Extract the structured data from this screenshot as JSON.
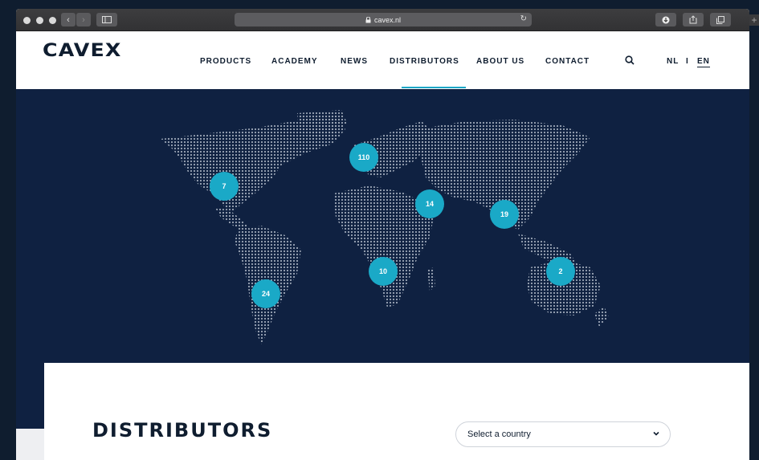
{
  "browser": {
    "url": "cavex.nl",
    "new_tab": "+"
  },
  "site": {
    "logo": "CAVEX",
    "nav": [
      {
        "label": "PRODUCTS"
      },
      {
        "label": "ACADEMY"
      },
      {
        "label": "NEWS"
      },
      {
        "label": "DISTRIBUTORS"
      },
      {
        "label": "ABOUT US"
      },
      {
        "label": "CONTACT"
      }
    ],
    "lang_nl": "NL",
    "lang_sep": "I",
    "lang_en": "EN"
  },
  "map": {
    "markers": [
      {
        "label": "7"
      },
      {
        "label": "110"
      },
      {
        "label": "14"
      },
      {
        "label": "19"
      },
      {
        "label": "10"
      },
      {
        "label": "2"
      },
      {
        "label": "24"
      }
    ]
  },
  "section": {
    "title": "DISTRIBUTORS",
    "select_placeholder": "Select a country"
  },
  "colors": {
    "accent": "#1aa9c7",
    "navy": "#0f2141",
    "ink": "#0f1d2f"
  }
}
